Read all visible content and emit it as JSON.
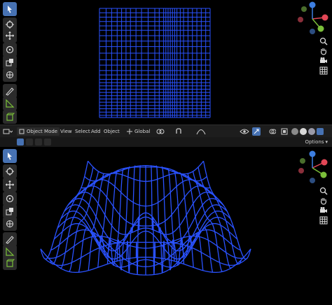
{
  "header": {
    "mode_label": "Object Mode",
    "menus": [
      "View",
      "Select",
      "Add",
      "Object"
    ],
    "orientation_label": "Global",
    "options_label": "Options"
  },
  "gizmo": {
    "axes": [
      "X",
      "Y",
      "Z"
    ],
    "colors": {
      "x": "#e34756",
      "y": "#7bbf3a",
      "z": "#3d7ee0",
      "neg": "#8a2f3a"
    }
  },
  "tools": [
    "select-box",
    "cursor",
    "move",
    "rotate",
    "scale",
    "transform",
    "annotate",
    "measure",
    "add-cube"
  ],
  "colors": {
    "wire": "#2a52ff",
    "accent": "#4772b3"
  }
}
